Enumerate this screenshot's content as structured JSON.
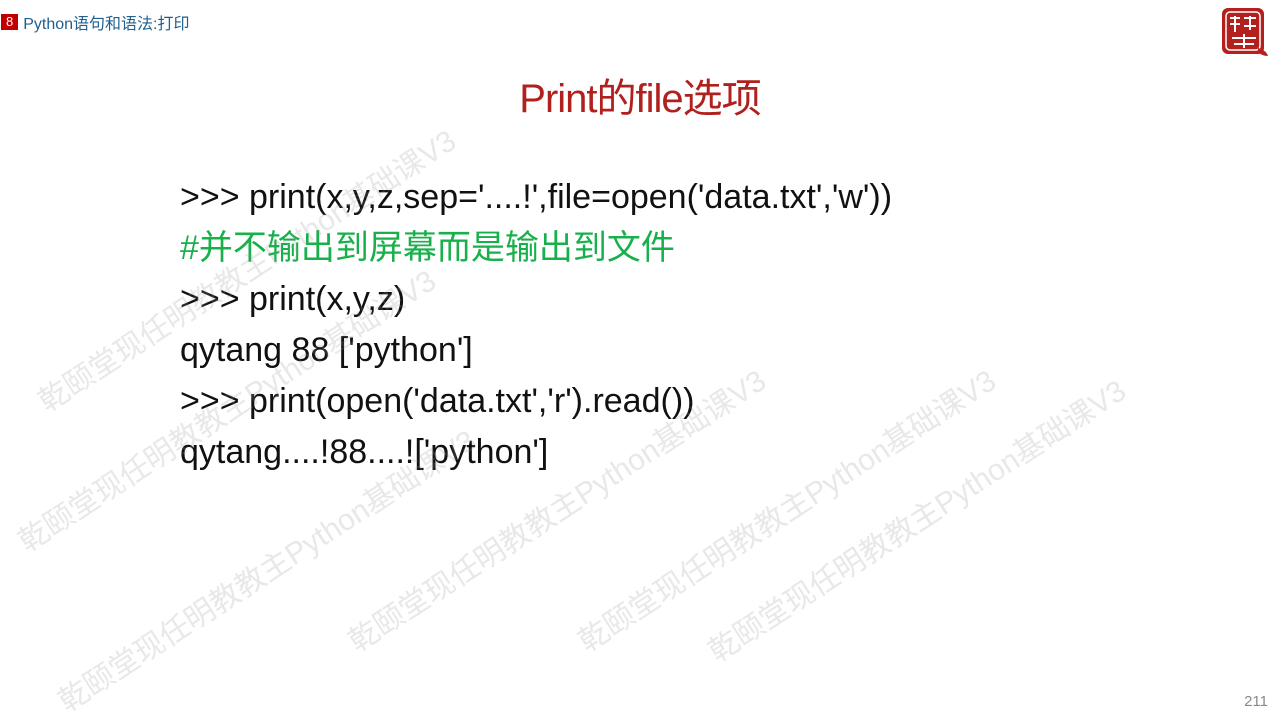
{
  "header": {
    "chapter_number": "8",
    "chapter_title": "Python语句和语法:打印"
  },
  "logo": {
    "text": "颐乾堂"
  },
  "slide": {
    "title": "Print的file选项",
    "lines": [
      ">>> print(x,y,z,sep='....!',file=open('data.txt','w'))",
      "#并不输出到屏幕而是输出到文件",
      ">>> print(x,y,z)",
      "qytang 88 ['python']",
      ">>> print(open('data.txt','r').read())",
      "qytang....!88....!['python']"
    ]
  },
  "watermark": {
    "text": "乾颐堂现任明教教主Python基础课V3"
  },
  "page_number": "211",
  "colors": {
    "accent_red": "#b0211e",
    "comment_green": "#18b04a",
    "badge_red": "#c00000",
    "header_blue": "#1f5f8f"
  }
}
